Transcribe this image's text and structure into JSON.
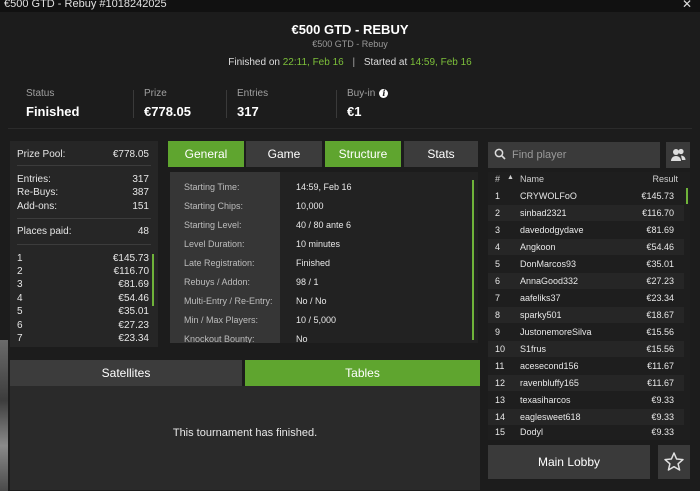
{
  "window": {
    "title": "€500 GTD - Rebuy #1018242025",
    "close": "✕"
  },
  "header": {
    "title": "€500 GTD - REBUY",
    "subtitle": "€500 GTD - Rebuy",
    "finished_label": "Finished on",
    "finished_value": "22:11, Feb 16",
    "separator": "|",
    "started_label": "Started at",
    "started_value": "14:59, Feb 16"
  },
  "stats": [
    {
      "label": "Status",
      "value": "Finished"
    },
    {
      "label": "Prize",
      "value": "€778.05"
    },
    {
      "label": "Entries",
      "value": "317"
    },
    {
      "label": "Buy-in",
      "value": "€1",
      "info_icon": "i"
    }
  ],
  "left_panel": {
    "prize_pool_label": "Prize Pool:",
    "prize_pool_value": "€778.05",
    "entries_label": "Entries:",
    "entries_value": "317",
    "rebuys_label": "Re-Buys:",
    "rebuys_value": "387",
    "addons_label": "Add-ons:",
    "addons_value": "151",
    "places_label": "Places paid:",
    "places_value": "48",
    "payouts": [
      {
        "place": "1",
        "amount": "€145.73"
      },
      {
        "place": "2",
        "amount": "€116.70"
      },
      {
        "place": "3",
        "amount": "€81.69"
      },
      {
        "place": "4",
        "amount": "€54.46"
      },
      {
        "place": "5",
        "amount": "€35.01"
      },
      {
        "place": "6",
        "amount": "€27.23"
      },
      {
        "place": "7",
        "amount": "€23.34"
      }
    ]
  },
  "tabs": [
    {
      "label": "General",
      "active": true
    },
    {
      "label": "Game",
      "active": false
    },
    {
      "label": "Structure",
      "active": true
    },
    {
      "label": "Stats",
      "active": false
    }
  ],
  "structure": [
    {
      "key": "Starting Time:",
      "value": "14:59, Feb 16"
    },
    {
      "key": "Starting Chips:",
      "value": "10,000"
    },
    {
      "key": "Starting Level:",
      "value": "40 / 80 ante 6"
    },
    {
      "key": "Level Duration:",
      "value": "10 minutes"
    },
    {
      "key": "Late Registration:",
      "value": "Finished"
    },
    {
      "key": "Rebuys / Addon:",
      "value": "98 / 1"
    },
    {
      "key": "Multi-Entry / Re-Entry:",
      "value": "No / No"
    },
    {
      "key": "Min / Max Players:",
      "value": "10 / 5,000"
    },
    {
      "key": "Knockout Bounty:",
      "value": "No"
    }
  ],
  "bottom_tabs": {
    "satellites": "Satellites",
    "tables": "Tables"
  },
  "bottom_message": "This tournament has finished.",
  "search": {
    "placeholder": "Find player"
  },
  "table": {
    "headers": {
      "num": "#",
      "sort": "▲",
      "name": "Name",
      "result": "Result"
    },
    "rows": [
      {
        "n": "1",
        "name": "CRYWOLFoO",
        "result": "€145.73"
      },
      {
        "n": "2",
        "name": "sinbad2321",
        "result": "€116.70"
      },
      {
        "n": "3",
        "name": "davedodgydave",
        "result": "€81.69"
      },
      {
        "n": "4",
        "name": "Angkoon",
        "result": "€54.46"
      },
      {
        "n": "5",
        "name": "DonMarcos93",
        "result": "€35.01"
      },
      {
        "n": "6",
        "name": "AnnaGood332",
        "result": "€27.23"
      },
      {
        "n": "7",
        "name": "aafeliks37",
        "result": "€23.34"
      },
      {
        "n": "8",
        "name": "sparky501",
        "result": "€18.67"
      },
      {
        "n": "9",
        "name": "JustonemoreSilva",
        "result": "€15.56"
      },
      {
        "n": "10",
        "name": "S1frus",
        "result": "€15.56"
      },
      {
        "n": "11",
        "name": "acesecond156",
        "result": "€11.67"
      },
      {
        "n": "12",
        "name": "ravenbluffy165",
        "result": "€11.67"
      },
      {
        "n": "13",
        "name": "texasiharcos",
        "result": "€9.33"
      },
      {
        "n": "14",
        "name": "eaglesweet618",
        "result": "€9.33"
      },
      {
        "n": "15",
        "name": "Dodyl",
        "result": "€9.33"
      }
    ]
  },
  "buttons": {
    "main_lobby": "Main Lobby"
  },
  "colors": {
    "accent": "#5fa52f",
    "time": "#7cbf3a",
    "bg": "#1c1c1c"
  },
  "icons": [
    "search-icon",
    "user-group-icon",
    "star-icon",
    "info-icon",
    "close-icon"
  ]
}
